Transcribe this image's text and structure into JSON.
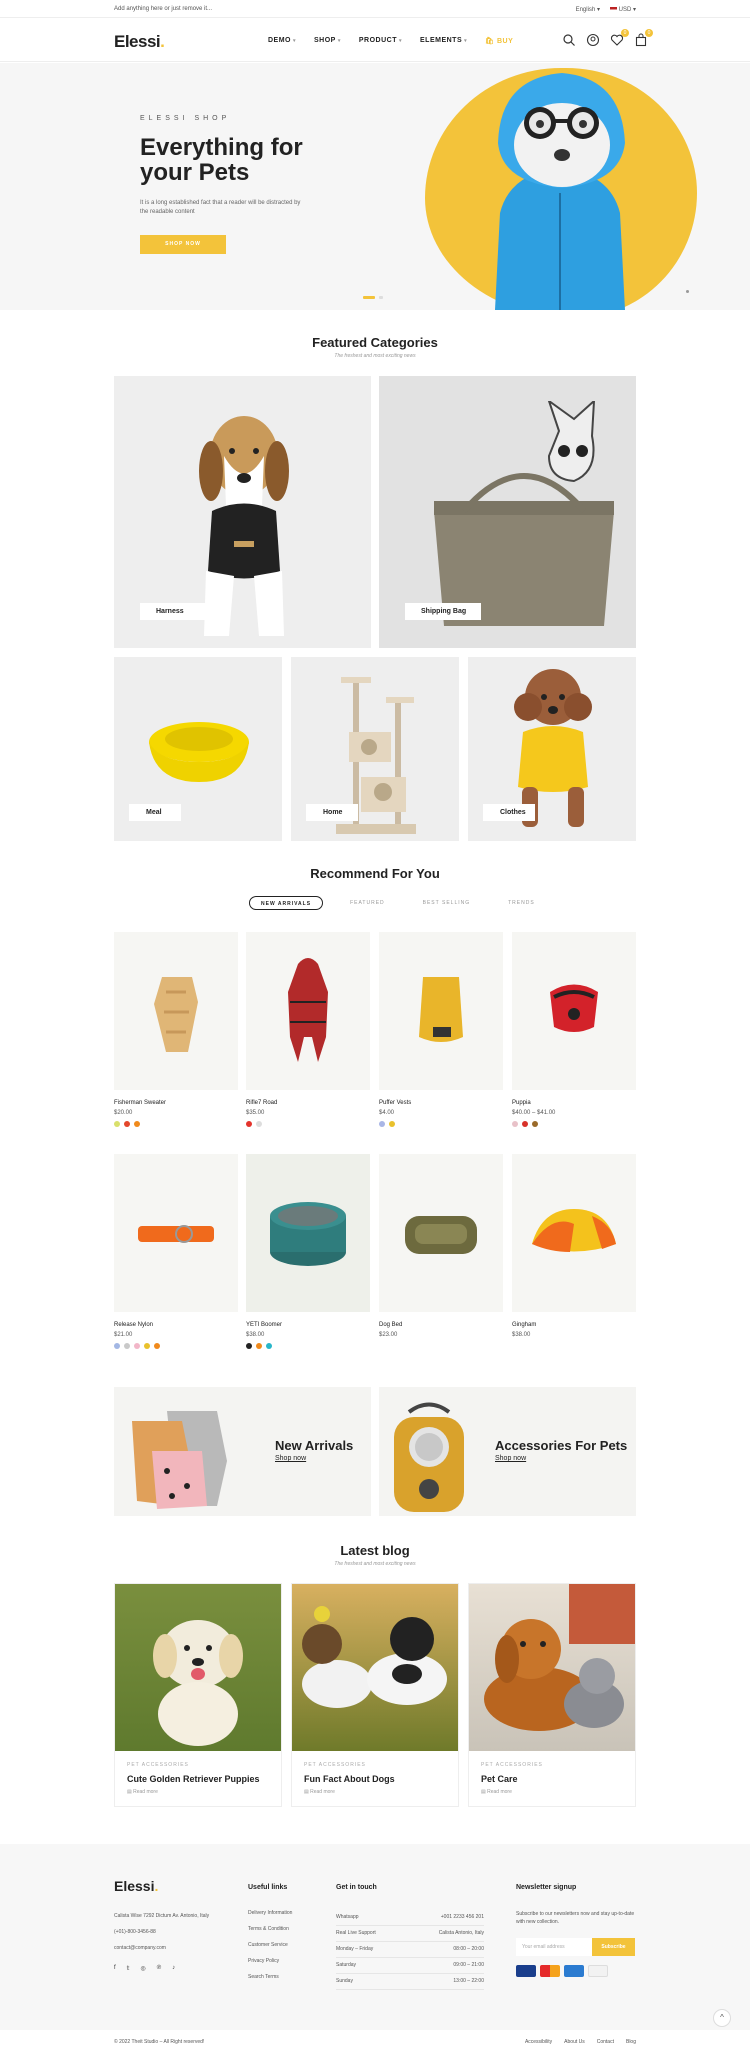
{
  "topbar": {
    "announce": "Add anything here or just remove it...",
    "language": "English",
    "currency": "USD"
  },
  "header": {
    "logo": "Elessi",
    "nav": [
      {
        "label": "DEMO"
      },
      {
        "label": "SHOP"
      },
      {
        "label": "PRODUCT"
      },
      {
        "label": "ELEMENTS"
      },
      {
        "label": "BUY"
      }
    ],
    "wishlist_count": "0",
    "cart_count": "0"
  },
  "hero": {
    "eyebrow": "ELESSI SHOP",
    "title": "Everything for your Pets",
    "description": "It is a long established fact that a reader will be distracted by the readable content",
    "button": "SHOP NOW"
  },
  "featured": {
    "title": "Featured Categories",
    "subtitle": "The freshest and most exciting news",
    "categories": [
      "Harness",
      "Shipping Bag",
      "Meal",
      "Home",
      "Clothes"
    ]
  },
  "recommend": {
    "title": "Recommend For You",
    "tabs": [
      "NEW ARRIVALS",
      "FEATURED",
      "BEST SELLING",
      "TRENDS"
    ],
    "products": [
      {
        "name": "Fisherman Sweater",
        "price": "$20.00",
        "swatches": [
          "#d9e06b",
          "#e4472c",
          "#f08a1c"
        ]
      },
      {
        "name": "Rifle7 Road",
        "price": "$35.00",
        "swatches": [
          "#e4332c",
          "#dddddd"
        ]
      },
      {
        "name": "Puffer Vests",
        "price": "$4.00",
        "swatches": [
          "#a9b6e6",
          "#e9c12c"
        ]
      },
      {
        "name": "Puppia",
        "price": "$40.00 – $41.00",
        "swatches": [
          "#e8c1c8",
          "#d8322a",
          "#9a6a2a"
        ]
      },
      {
        "name": "Release Nylon",
        "price": "$21.00",
        "swatches": [
          "#a3b7e4",
          "#c9c9c9",
          "#f2b6c8",
          "#e9c12c",
          "#f08a1c"
        ]
      },
      {
        "name": "YETI Boomer",
        "price": "$38.00",
        "swatches": [
          "#222222",
          "#f08a1c",
          "#28b6c9"
        ]
      },
      {
        "name": "Dog Bed",
        "price": "$23.00",
        "swatches": []
      },
      {
        "name": "Gingham",
        "price": "$38.00",
        "swatches": []
      }
    ]
  },
  "banners": [
    {
      "title": "New Arrivals",
      "link": "Shop now"
    },
    {
      "title": "Accessories For Pets",
      "link": "Shop now"
    }
  ],
  "blog": {
    "title": "Latest blog",
    "subtitle": "The freshest and most exciting news",
    "posts": [
      {
        "category": "PET ACCESSORIES",
        "title": "Cute Golden Retriever Puppies",
        "link": "Read more"
      },
      {
        "category": "PET ACCESSORIES",
        "title": "Fun Fact About Dogs",
        "link": "Read more"
      },
      {
        "category": "PET ACCESSORIES",
        "title": "Pet Care",
        "link": "Read more"
      }
    ]
  },
  "footer": {
    "logo": "Elessi",
    "address": "Calista Wise 7292 Dictum Av. Antonio, Italy",
    "phone": "(+01)-800-3456-88",
    "email": "contact@company.com",
    "useful_title": "Useful links",
    "useful_links": [
      "Delivery Information",
      "Terms & Condition",
      "Customer Service",
      "Privacy Policy",
      "Search Terms"
    ],
    "touch_title": "Get in touch",
    "touch_rows": [
      {
        "label": "Whatsapp",
        "value": "+001 2233 456 201"
      },
      {
        "label": "Real Live Support",
        "value": "Calista Antonio, Italy"
      },
      {
        "label": "Monday – Friday",
        "value": "08:00 – 20:00"
      },
      {
        "label": "Saturday",
        "value": "09:00 – 21:00"
      },
      {
        "label": "Sunday",
        "value": "13:00 – 22:00"
      }
    ],
    "newsletter_title": "Newsletter signup",
    "newsletter_text": "Subscribe to our newsletters now and stay up-to-date with new collection.",
    "newsletter_placeholder": "Your email address",
    "subscribe": "Subscribe"
  },
  "bottom": {
    "copyright": "© 2022 Theit Studio – All Right reserved!",
    "links": [
      "Accessibility",
      "About Us",
      "Contact",
      "Blog"
    ]
  },
  "colors": {
    "accent": "#f3c33a",
    "text": "#222222"
  }
}
